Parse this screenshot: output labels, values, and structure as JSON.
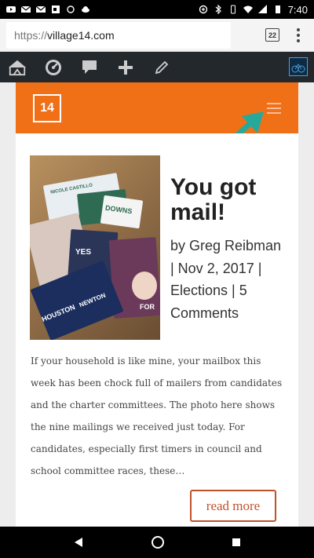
{
  "status_bar": {
    "time": "7:40",
    "icons_left": [
      "youtube-icon",
      "gmail-icon",
      "gmail-icon",
      "office-icon",
      "sync-icon",
      "cloud-icon"
    ],
    "icons_right": [
      "data-saver-icon",
      "bluetooth-icon",
      "vibrate-icon",
      "wifi-icon",
      "signal-icon",
      "battery-icon"
    ]
  },
  "browser": {
    "url_scheme": "https://",
    "url_host": "village14.com",
    "tab_count": "22"
  },
  "admin_bar": {
    "icons": [
      "my-sites-icon",
      "dashboard-icon",
      "comments-icon",
      "new-post-icon",
      "edit-icon",
      "avatar"
    ]
  },
  "site": {
    "logo_text": "14",
    "accent": "#f07018"
  },
  "post": {
    "title": "You got mail!",
    "meta": "by Greg Reibman | Nov 2, 2017 | Elections | 5 Comments",
    "excerpt": "If your household is like mine, your mailbox this week has been chock full of mailers from candidates and the charter committees. The photo here shows the nine mailings we received just today. For candidates, especially first timers in council and school committee races, these…",
    "read_more": "read more",
    "thumb_texts": [
      "NICOLE CASTILLO",
      "DOWNS",
      "YES",
      "HOUSTON",
      "NEWTON",
      "FOR"
    ]
  },
  "annotation": {
    "arrow_color": "#26a99a"
  }
}
